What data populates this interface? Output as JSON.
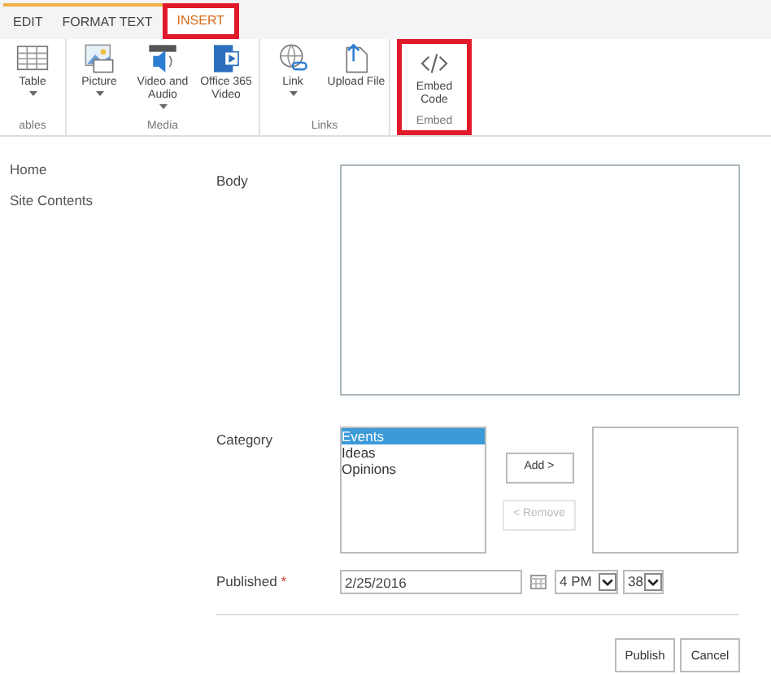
{
  "ribbon_tabs": [
    {
      "label": "EDIT",
      "selected": false,
      "highlighted": false
    },
    {
      "label": "FORMAT TEXT",
      "selected": false,
      "highlighted": false
    },
    {
      "label": "INSERT",
      "selected": true,
      "highlighted": true
    }
  ],
  "ribbon_groups": [
    {
      "name": "ables",
      "highlighted": false,
      "commands": [
        {
          "kind": "table",
          "label": "Table",
          "dropdown": true
        }
      ]
    },
    {
      "name": "Media",
      "highlighted": false,
      "commands": [
        {
          "kind": "picture",
          "label": "Picture",
          "dropdown": true
        },
        {
          "kind": "video",
          "label": "Video and Audio",
          "dropdown": true
        },
        {
          "kind": "office-video",
          "label": "Office 365 Video",
          "dropdown": false
        }
      ]
    },
    {
      "name": "Links",
      "highlighted": false,
      "commands": [
        {
          "kind": "link",
          "label": "Link",
          "dropdown": true
        },
        {
          "kind": "upload",
          "label": "Upload File",
          "dropdown": false
        }
      ]
    },
    {
      "name": "Embed",
      "highlighted": true,
      "commands": [
        {
          "kind": "embed",
          "label": "Embed Code",
          "dropdown": false
        }
      ]
    }
  ],
  "nav": [
    "Home",
    "Site Contents"
  ],
  "form": {
    "body_label": "Body",
    "category_label": "Category",
    "category_options": [
      {
        "label": "Events",
        "selected": true
      },
      {
        "label": "Ideas",
        "selected": false
      },
      {
        "label": "Opinions",
        "selected": false
      }
    ],
    "add_button": {
      "label": "Add >",
      "disabled": false
    },
    "remove_button": {
      "label": "< Remove",
      "disabled": true
    },
    "published_label": "Published",
    "required_mark": "*",
    "date": "2/25/2016",
    "hour": "4 PM",
    "minute": "38"
  },
  "buttons": [
    "Publish",
    "Cancel"
  ]
}
